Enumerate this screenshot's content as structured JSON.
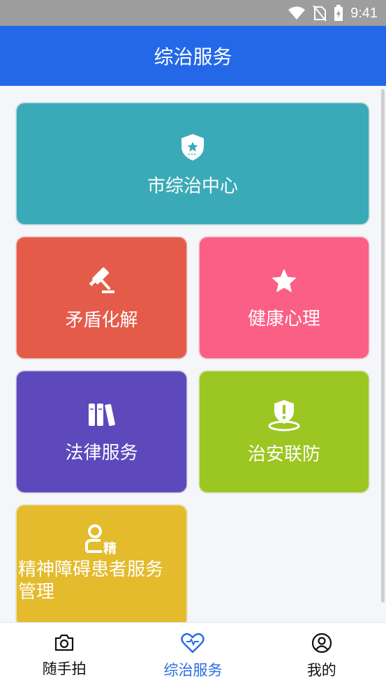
{
  "status_bar": {
    "time": "9:41",
    "icons": [
      "wifi-icon",
      "no-sim-icon",
      "battery-charging-icon"
    ]
  },
  "header": {
    "title": "综治服务"
  },
  "tiles": [
    {
      "label": "市综治中心",
      "icon": "police-shield-icon",
      "color": "#3aaab8"
    },
    {
      "label": "矛盾化解",
      "icon": "gavel-icon",
      "color": "#e55b4a"
    },
    {
      "label": "健康心理",
      "icon": "star-icon",
      "color": "#fb5f85"
    },
    {
      "label": "法律服务",
      "icon": "books-icon",
      "color": "#5d49bc"
    },
    {
      "label": "治安联防",
      "icon": "alert-shield-location-icon",
      "color": "#9cc621"
    },
    {
      "label": "精神障碍患者服务管理",
      "label_line1": "精神障碍患者服务",
      "label_line2": "管理",
      "icon": "person-badge-icon",
      "badge_text": "精",
      "color": "#e3bb2c"
    }
  ],
  "bottom_nav": [
    {
      "label": "随手拍",
      "icon": "camera-icon",
      "active": false
    },
    {
      "label": "综治服务",
      "icon": "heart-icon",
      "active": true
    },
    {
      "label": "我的",
      "icon": "user-circle-icon",
      "active": false
    }
  ],
  "colors": {
    "primary": "#2468e8",
    "active_nav": "#2a6de3",
    "status_bar": "#9e9e9e"
  }
}
